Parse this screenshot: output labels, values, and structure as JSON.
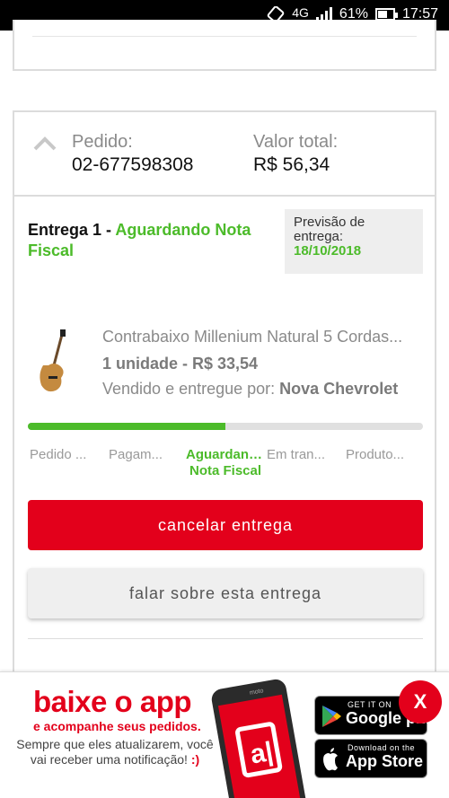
{
  "status_bar": {
    "network": "4G",
    "battery_percent": "61%",
    "battery_level": 0.61,
    "time": "17:57"
  },
  "order": {
    "pedido_label": "Pedido:",
    "pedido_number": "02-677598308",
    "total_label": "Valor total:",
    "total_value": "R$ 56,34",
    "collapse_icon": "chevron-up-icon"
  },
  "delivery": {
    "title": "Entrega 1 - ",
    "status": "Aguardando Nota Fiscal",
    "forecast_label": "Previsão de entrega:",
    "forecast_date": "18/10/2018"
  },
  "product": {
    "name": "Contrabaixo Millenium Natural 5 Cordas...",
    "quantity_price": "1 unidade - R$ 33,54",
    "seller_label": "Vendido e entregue por: ",
    "seller_name": "Nova Chevrolet"
  },
  "progress": {
    "fraction": 0.5,
    "steps": [
      "Pedido ...",
      "Pagam...",
      "Aguardando Nota Fiscal",
      "Em tran...",
      "Produto..."
    ],
    "active_index": 2
  },
  "actions": {
    "cancel_label": "cancelar entrega",
    "talk_label": "falar sobre esta entrega"
  },
  "banner": {
    "title": "baixe o app",
    "subtitle": "e acompanhe seus pedidos.",
    "text": "Sempre que eles atualizarem, você vai receber uma notificação!",
    "smiley": ":)",
    "phone_brand": "moto",
    "phone_logo": "a|",
    "google_small": "GET IT ON",
    "google_big": "Google play",
    "apple_small": "Download on the",
    "apple_big": "App Store",
    "close_label": "X"
  },
  "colors": {
    "accent_red": "#e3001b",
    "status_green": "#4cbb2a"
  }
}
